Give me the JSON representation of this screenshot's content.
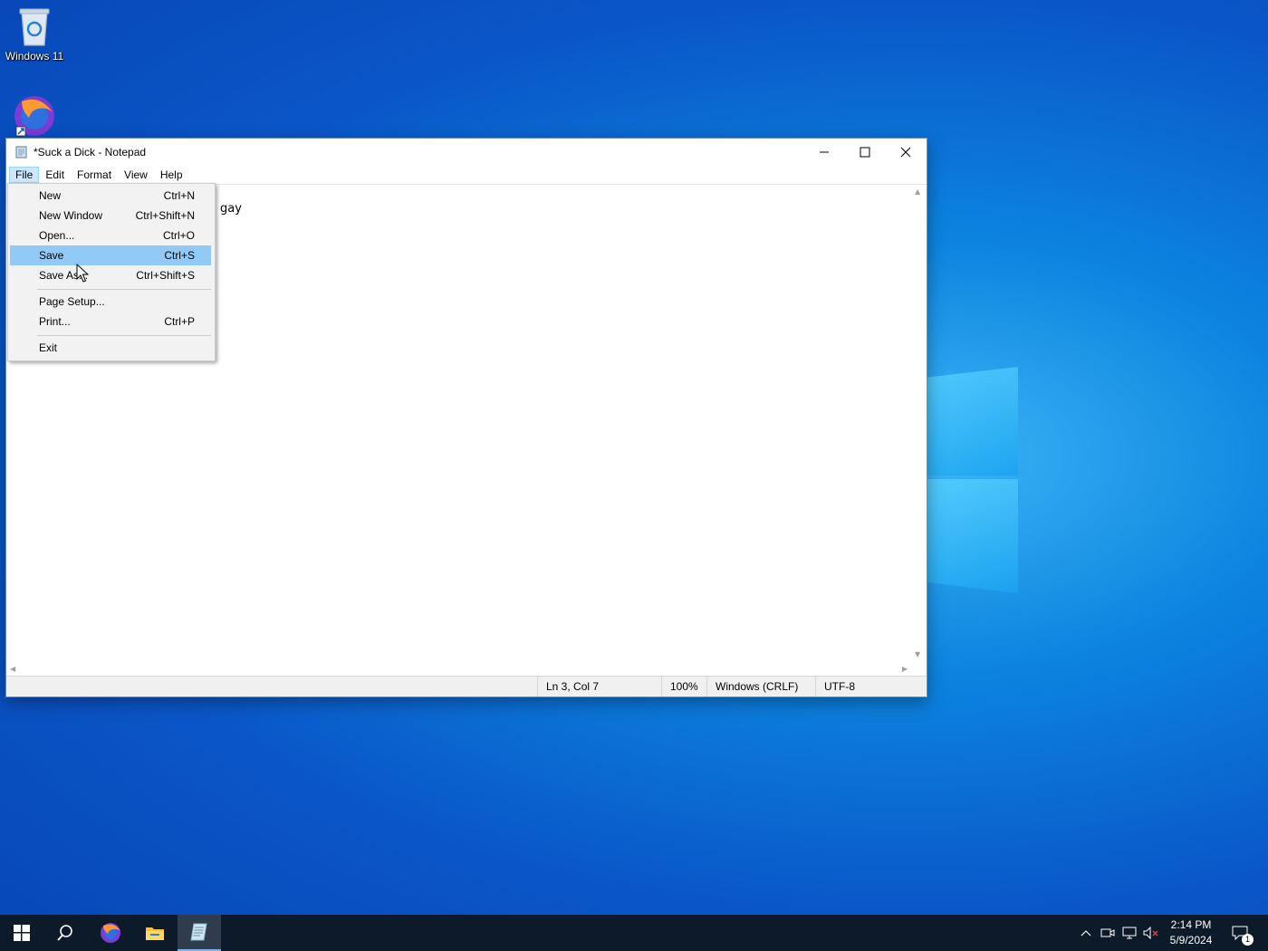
{
  "desktop": {
    "icons": [
      {
        "label": "Windows 11",
        "icon": "recycle-bin-icon"
      },
      {
        "label": "",
        "icon": "firefox-shortcut-icon"
      }
    ]
  },
  "window": {
    "title": "*Suck a Dick - Notepad",
    "menu": [
      "File",
      "Edit",
      "Format",
      "View",
      "Help"
    ],
    "active_menu": "File",
    "editor_text": "gay",
    "status": {
      "position": "Ln 3, Col 7",
      "zoom": "100%",
      "line_ending": "Windows (CRLF)",
      "encoding": "UTF-8"
    }
  },
  "file_menu": {
    "items": [
      {
        "label": "New",
        "shortcut": "Ctrl+N"
      },
      {
        "label": "New Window",
        "shortcut": "Ctrl+Shift+N"
      },
      {
        "label": "Open...",
        "shortcut": "Ctrl+O"
      },
      {
        "label": "Save",
        "shortcut": "Ctrl+S",
        "highlighted": true
      },
      {
        "label": "Save As...",
        "shortcut": "Ctrl+Shift+S"
      },
      {
        "label": "Page Setup...",
        "shortcut": ""
      },
      {
        "label": "Print...",
        "shortcut": "Ctrl+P"
      },
      {
        "label": "Exit",
        "shortcut": ""
      }
    ]
  },
  "taskbar": {
    "buttons": [
      "start-icon",
      "search-icon",
      "firefox-icon",
      "file-explorer-icon",
      "notepad-icon"
    ],
    "active_button": "notepad-icon",
    "clock": {
      "time": "2:14 PM",
      "date": "5/9/2024"
    },
    "notification_count": "1"
  },
  "colors": {
    "highlight": "#91c9f7",
    "menu_active": "#cce8ff",
    "taskbar": "#0d1a2a"
  }
}
